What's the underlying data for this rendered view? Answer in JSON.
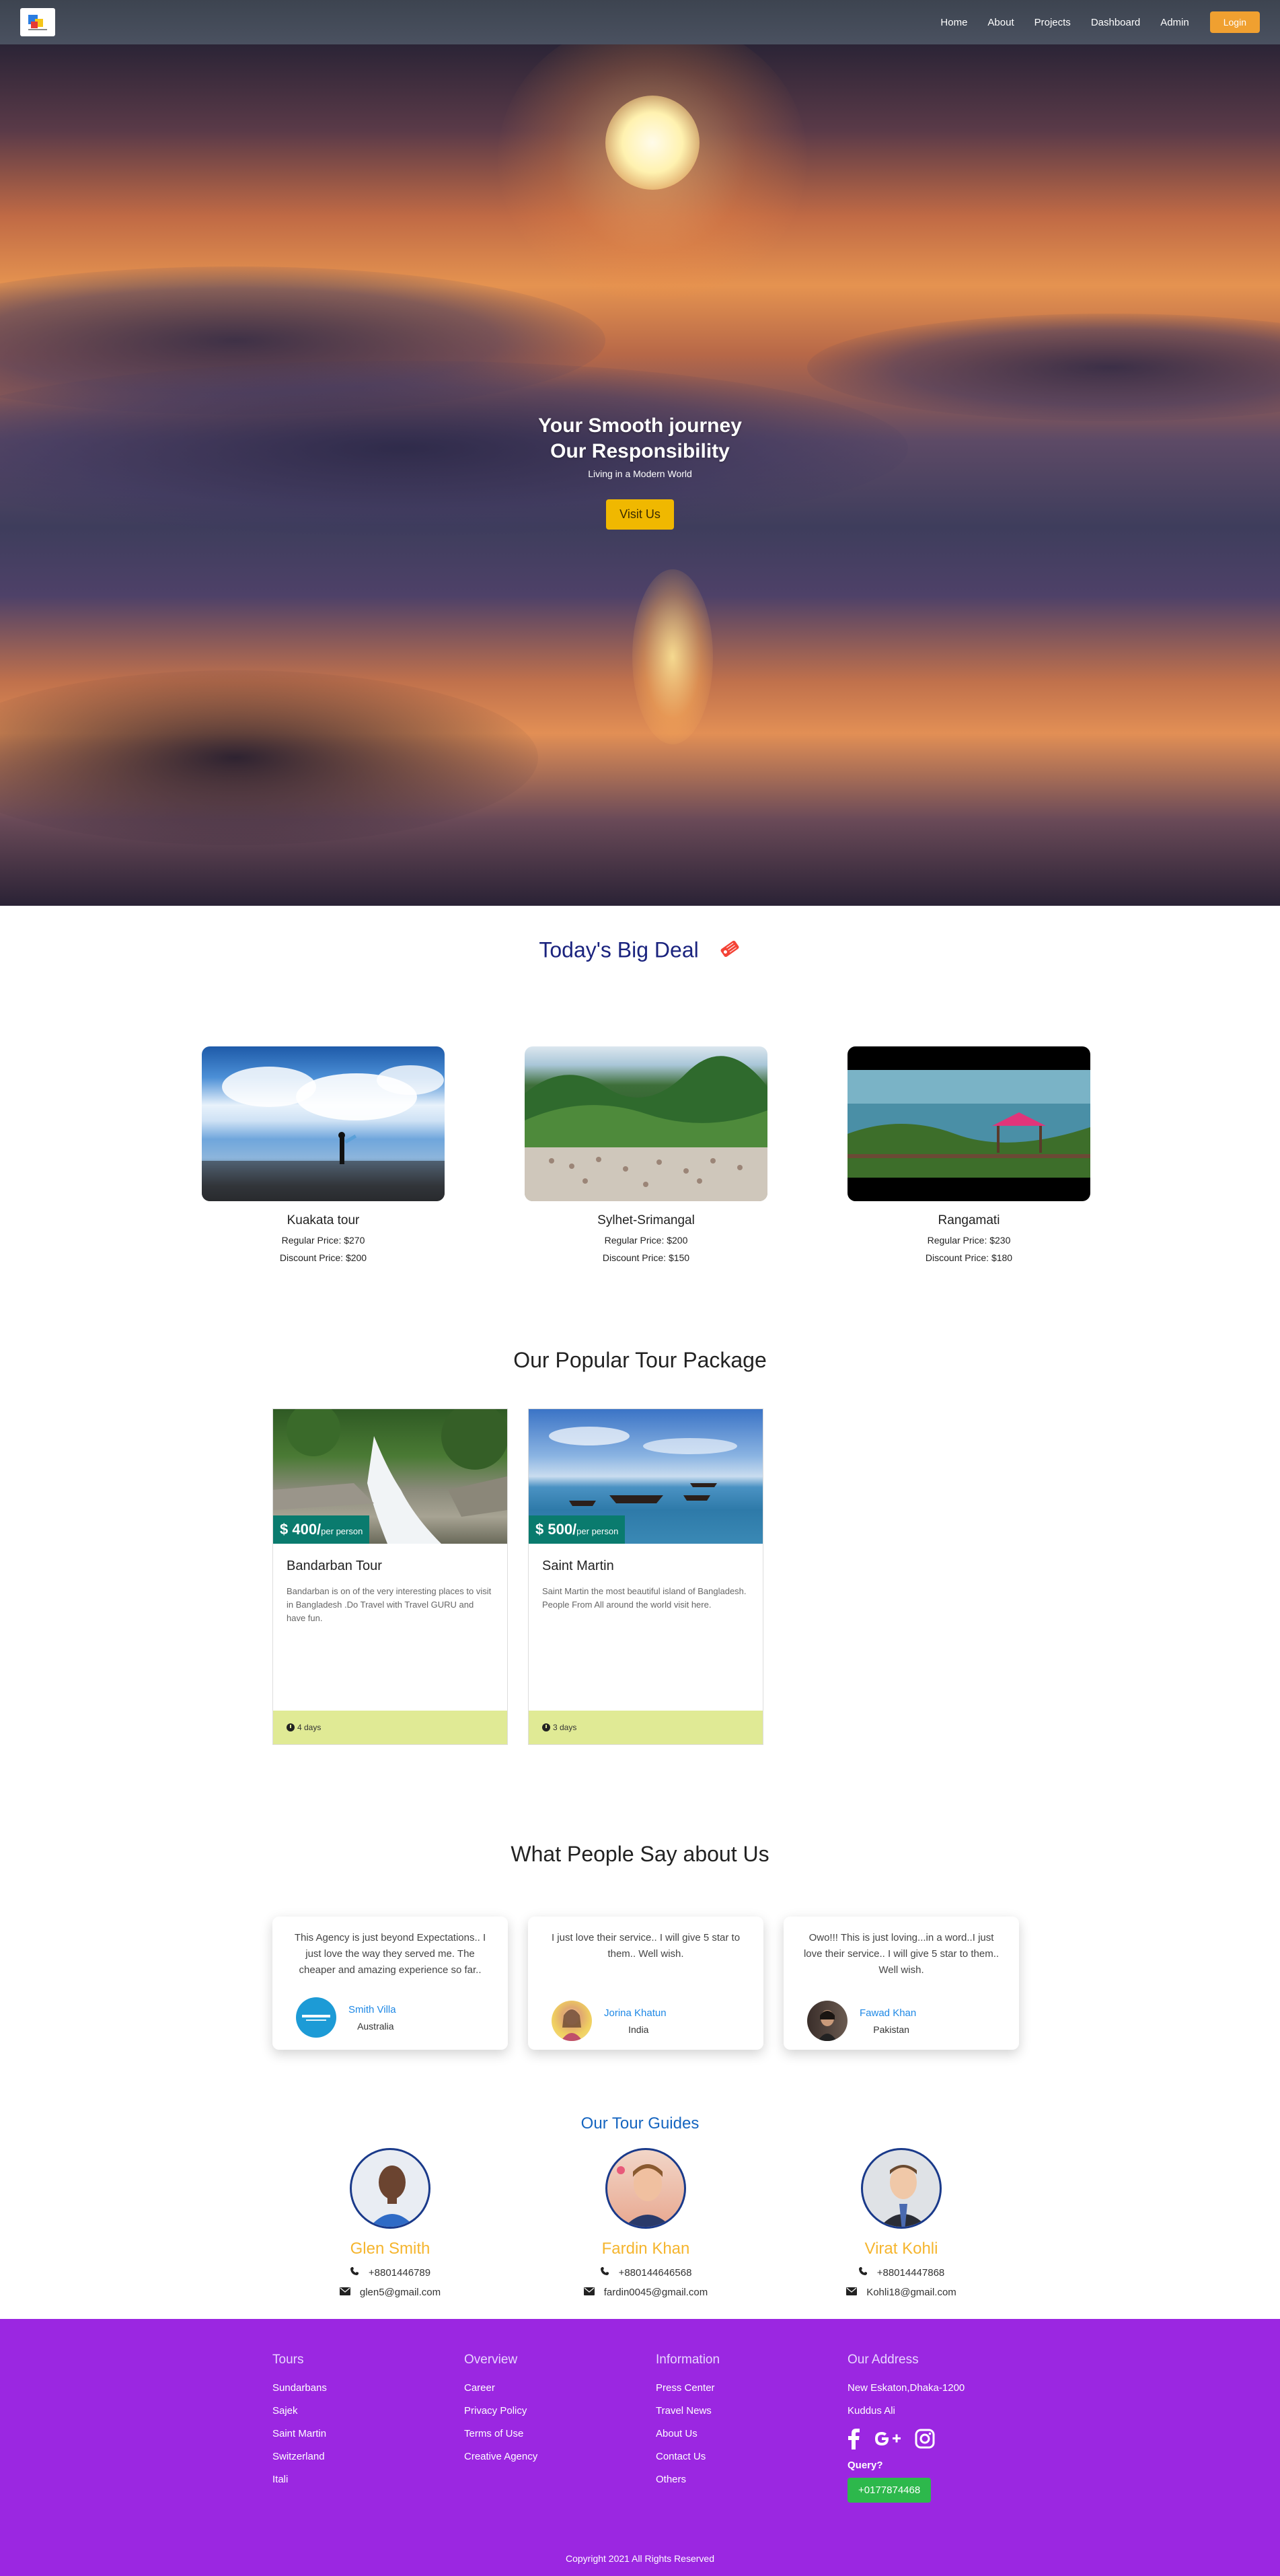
{
  "nav": {
    "logo": "site-logo",
    "links": [
      "Home",
      "About",
      "Projects",
      "Dashboard",
      "Admin"
    ],
    "login": "Login"
  },
  "hero": {
    "title_line1": "Your Smooth journey",
    "title_line2": "Our Responsibility",
    "subtitle": "Living in a Modern World",
    "cta": "Visit Us"
  },
  "big_deal": {
    "title": "Today's Big Deal",
    "tag_icon": "price-tag-icon",
    "cards": [
      {
        "name": "Kuakata tour",
        "regular": "Regular Price: $270",
        "discount": "Discount Price: $200"
      },
      {
        "name": "Sylhet-Srimangal",
        "regular": "Regular Price: $200",
        "discount": "Discount Price: $150"
      },
      {
        "name": "Rangamati",
        "regular": "Regular Price: $230",
        "discount": "Discount Price: $180"
      }
    ]
  },
  "popular": {
    "title": "Our Popular Tour Package",
    "packages": [
      {
        "price": "$ 400/",
        "per": "per person",
        "name": "Bandarban Tour",
        "desc": "Bandarban is on of the very interesting places to visit in Bangladesh .Do Travel with Travel GURU and have fun.",
        "days": "4 days"
      },
      {
        "price": "$ 500/",
        "per": "per person",
        "name": "Saint Martin",
        "desc": "Saint Martin the most beautiful island of Bangladesh. People From All around the world visit here.",
        "days": "3 days"
      }
    ]
  },
  "testimonials": {
    "title": "What People Say about Us",
    "reviews": [
      {
        "text": "This Agency is just beyond Expectations.. I just love the way they served me. The cheaper and amazing experience so far..",
        "name": "Smith Villa",
        "country": "Australia"
      },
      {
        "text": "I just love their service.. I will give 5 star to them.. Well wish.",
        "name": "Jorina Khatun",
        "country": "India"
      },
      {
        "text": "Owo!!! This is just loving...in a word..I just love their service.. I will give 5 star to them.. Well wish.",
        "name": "Fawad Khan",
        "country": "Pakistan"
      }
    ]
  },
  "guides": {
    "title": "Our Tour Guides",
    "list": [
      {
        "name": "Glen Smith",
        "phone": "+8801446789",
        "email": "glen5@gmail.com"
      },
      {
        "name": "Fardin Khan",
        "phone": "+880144646568",
        "email": "fardin0045@gmail.com"
      },
      {
        "name": "Virat Kohli",
        "phone": "+88014447868",
        "email": "Kohli18@gmail.com"
      }
    ]
  },
  "footer": {
    "tours": {
      "title": "Tours",
      "items": [
        "Sundarbans",
        "Sajek",
        "Saint Martin",
        "Switzerland",
        "Itali"
      ]
    },
    "overview": {
      "title": "Overview",
      "items": [
        "Career",
        "Privacy Policy",
        "Terms of Use",
        "Creative Agency"
      ]
    },
    "information": {
      "title": "Information",
      "items": [
        "Press Center",
        "Travel News",
        "About Us",
        "Contact Us",
        "Others"
      ]
    },
    "address": {
      "title": "Our Address",
      "line1": "New Eskaton,Dhaka-1200",
      "line2": "Kuddus Ali",
      "query": "Query?",
      "phone": "+0177874468"
    },
    "social_icons": [
      "facebook-icon",
      "google-plus-icon",
      "instagram-icon"
    ],
    "copyright": "Copyright 2021 All Rights Reserved"
  },
  "colors": {
    "nav_bg": "#434a56",
    "login": "#f0a030",
    "cta": "#f0b800",
    "deal_title": "#1a237e",
    "pkg_price_bg": "#0a7b6e",
    "pkg_footer": "#e0ea95",
    "guide_name": "#f5b52e",
    "footer_bg": "#9b27e1",
    "phone_btn": "#2db84c"
  }
}
